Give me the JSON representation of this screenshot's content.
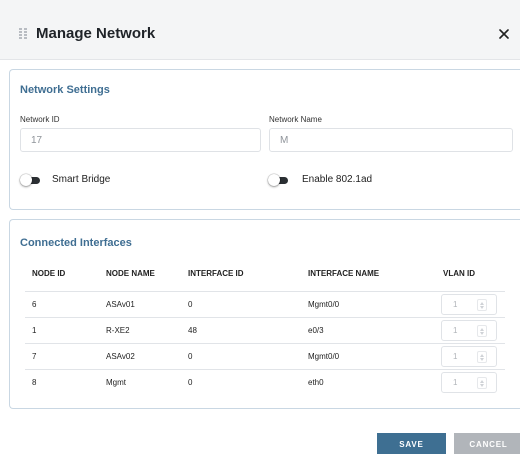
{
  "dialog": {
    "title": "Manage Network",
    "icons": {
      "drag": "drag-handle-icon",
      "close": "close-icon"
    }
  },
  "network_settings": {
    "title": "Network Settings",
    "network_id": {
      "label": "Network ID",
      "value": "17"
    },
    "network_name": {
      "label": "Network Name",
      "value": "M"
    },
    "smart_bridge": {
      "label": "Smart Bridge",
      "enabled": false
    },
    "enable_8021ad": {
      "label": "Enable 802.1ad",
      "enabled": false
    }
  },
  "connected_interfaces": {
    "title": "Connected Interfaces",
    "columns": [
      "NODE ID",
      "NODE NAME",
      "INTERFACE ID",
      "INTERFACE NAME",
      "VLAN ID"
    ],
    "rows": [
      {
        "node_id": "6",
        "node_name": "ASAv01",
        "interface_id": "0",
        "interface_name": "Mgmt0/0",
        "vlan_id": "1"
      },
      {
        "node_id": "1",
        "node_name": "R-XE2",
        "interface_id": "48",
        "interface_name": "e0/3",
        "vlan_id": "1"
      },
      {
        "node_id": "7",
        "node_name": "ASAv02",
        "interface_id": "0",
        "interface_name": "Mgmt0/0",
        "vlan_id": "1"
      },
      {
        "node_id": "8",
        "node_name": "Mgmt",
        "interface_id": "0",
        "interface_name": "eth0",
        "vlan_id": "1"
      }
    ]
  },
  "footer": {
    "save_label": "SAVE",
    "cancel_label": "CANCEL"
  },
  "colors": {
    "accent": "#3e6f92",
    "section_title": "#3f6e92",
    "header_bg": "#f4f5f6",
    "cancel_bg": "#b1b5ba",
    "panel_border": "#c9d7e3"
  }
}
